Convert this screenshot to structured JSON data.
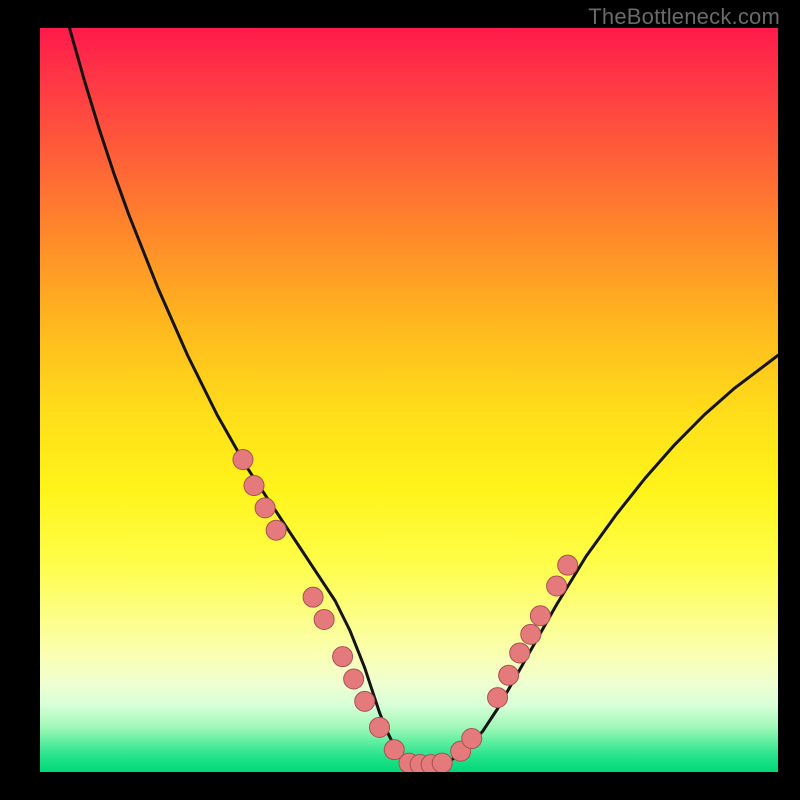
{
  "watermark": "TheBottleneck.com",
  "colors": {
    "curve_stroke": "#141414",
    "marker_fill": "#e57a7d",
    "marker_stroke": "#aa5052"
  },
  "chart_data": {
    "type": "line",
    "title": "",
    "xlabel": "",
    "ylabel": "",
    "xlim": [
      0,
      100
    ],
    "ylim": [
      0,
      100
    ],
    "grid": false,
    "series": [
      {
        "name": "bottleneck-curve",
        "x": [
          4,
          6,
          8,
          10,
          12,
          14,
          16,
          18,
          20,
          22,
          24,
          26,
          28,
          30,
          32,
          34,
          36,
          38,
          40,
          41,
          42,
          43,
          44,
          45,
          46,
          47,
          48,
          49,
          50,
          51,
          52,
          53,
          54,
          55,
          56,
          58,
          60,
          62,
          64,
          66,
          68,
          70,
          74,
          78,
          82,
          86,
          90,
          94,
          98,
          100
        ],
        "y": [
          100,
          93,
          86.5,
          80.5,
          75,
          70,
          65,
          60.5,
          56,
          52,
          48,
          44.5,
          41,
          38,
          35,
          32,
          29,
          26,
          23,
          21,
          19,
          16.5,
          14,
          11,
          8,
          5.5,
          3.5,
          2,
          1.2,
          1,
          1,
          1,
          1,
          1.2,
          1.8,
          3.2,
          5.5,
          8.5,
          12,
          15.5,
          19,
          22.5,
          29,
          34.5,
          39.5,
          44,
          48,
          51.5,
          54.5,
          56
        ]
      }
    ],
    "markers": [
      {
        "x": 27.5,
        "y": 42
      },
      {
        "x": 29,
        "y": 38.5
      },
      {
        "x": 30.5,
        "y": 35.5
      },
      {
        "x": 32,
        "y": 32.5
      },
      {
        "x": 37,
        "y": 23.5
      },
      {
        "x": 38.5,
        "y": 20.5
      },
      {
        "x": 41,
        "y": 15.5
      },
      {
        "x": 42.5,
        "y": 12.5
      },
      {
        "x": 44,
        "y": 9.5
      },
      {
        "x": 46,
        "y": 6
      },
      {
        "x": 48,
        "y": 3
      },
      {
        "x": 50,
        "y": 1.2
      },
      {
        "x": 51.5,
        "y": 1
      },
      {
        "x": 53,
        "y": 1
      },
      {
        "x": 54.5,
        "y": 1.2
      },
      {
        "x": 57,
        "y": 2.8
      },
      {
        "x": 58.5,
        "y": 4.5
      },
      {
        "x": 62,
        "y": 10
      },
      {
        "x": 63.5,
        "y": 13
      },
      {
        "x": 65,
        "y": 16
      },
      {
        "x": 66.5,
        "y": 18.5
      },
      {
        "x": 67.8,
        "y": 21
      },
      {
        "x": 70,
        "y": 25
      },
      {
        "x": 71.5,
        "y": 27.8
      }
    ]
  }
}
